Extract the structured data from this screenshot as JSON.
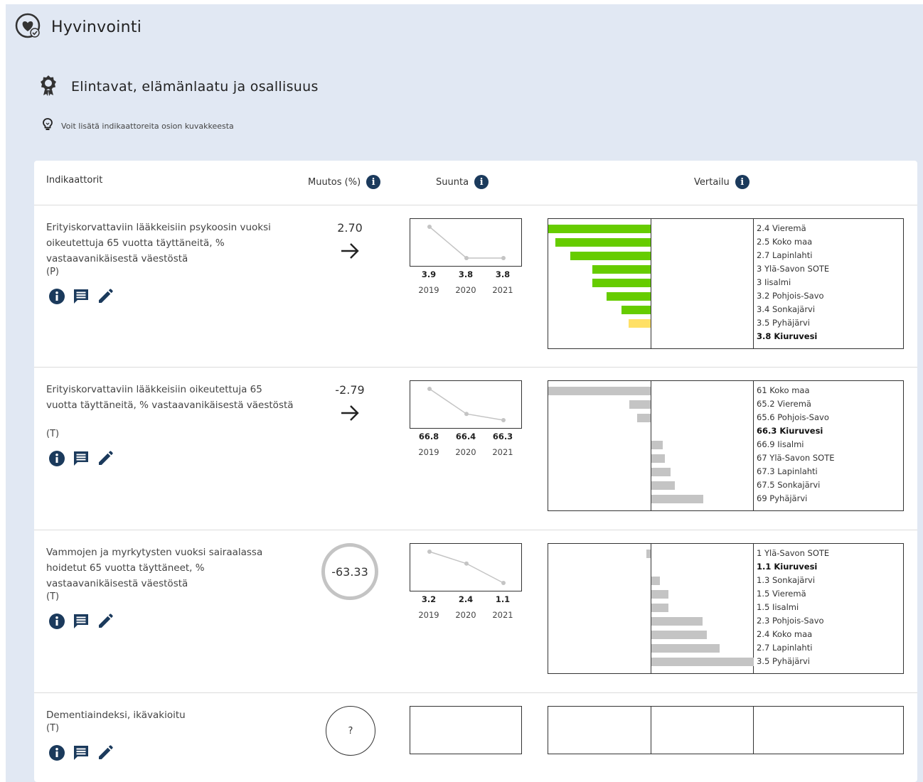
{
  "header": {
    "title": "Hyvinvointi",
    "icon": "heart-check-icon"
  },
  "section": {
    "title": "Elintavat, elämänlaatu ja osallisuus",
    "icon": "award-ribbon-icon"
  },
  "hint": {
    "text": "Voit lisätä indikaattoreita osion kuvakkeesta",
    "icon": "lightbulb-icon"
  },
  "columns": {
    "indicators": "Indikaattorit",
    "change": "Muutos (%)",
    "trend": "Suunta",
    "comparison": "Vertailu"
  },
  "colors": {
    "background": "#e1e8f3",
    "info_badge": "#1b3a5c",
    "bar_good": "#66cc00",
    "bar_mid": "#ffe066",
    "bar_neutral": "#c4c4c4"
  },
  "rows": [
    {
      "name": "Erityiskorvattaviin lääkkeisiin psykoosin vuoksi oikeutettuja 65 vuotta täyttäneitä, % vastaavanikäisestä väestöstä",
      "code": "(P)",
      "change": "2.70",
      "change_display": "arrow",
      "arrow": "→",
      "trend": {
        "years": [
          "2019",
          "2020",
          "2021"
        ],
        "values_text": [
          "3.9",
          "3.8",
          "3.8"
        ],
        "values": [
          3.9,
          3.8,
          3.8
        ]
      },
      "comparison": [
        {
          "value": 2.4,
          "text": "2.4 Vieremä",
          "color": "#66cc00",
          "highlight": false
        },
        {
          "value": 2.5,
          "text": "2.5 Koko maa",
          "color": "#66cc00",
          "highlight": false
        },
        {
          "value": 2.7,
          "text": "2.7 Lapinlahti",
          "color": "#66cc00",
          "highlight": false
        },
        {
          "value": 3.0,
          "text": "3 Ylä-Savon SOTE",
          "color": "#66cc00",
          "highlight": false
        },
        {
          "value": 3.0,
          "text": "3 Iisalmi",
          "color": "#66cc00",
          "highlight": false
        },
        {
          "value": 3.2,
          "text": "3.2 Pohjois-Savo",
          "color": "#66cc00",
          "highlight": false
        },
        {
          "value": 3.4,
          "text": "3.4 Sonkajärvi",
          "color": "#66cc00",
          "highlight": false
        },
        {
          "value": 3.5,
          "text": "3.5 Pyhäjärvi",
          "color": "#ffe066",
          "highlight": false
        },
        {
          "value": 3.8,
          "text": "3.8 Kiuruvesi",
          "color": null,
          "highlight": true
        }
      ]
    },
    {
      "name": "Erityiskorvattaviin lääkkeisiin oikeutettuja 65 vuotta täyttäneitä, % vastaavanikäisestä väestöstä",
      "code": "(T)",
      "change": "-2.79",
      "change_display": "arrow",
      "arrow": "→",
      "trend": {
        "years": [
          "2019",
          "2020",
          "2021"
        ],
        "values_text": [
          "66.8",
          "66.4",
          "66.3"
        ],
        "values": [
          66.8,
          66.4,
          66.3
        ]
      },
      "comparison": [
        {
          "value": 61,
          "text": "61 Koko maa",
          "color": "#c4c4c4",
          "highlight": false
        },
        {
          "value": 65.2,
          "text": "65.2 Vieremä",
          "color": "#c4c4c4",
          "highlight": false
        },
        {
          "value": 65.6,
          "text": "65.6 Pohjois-Savo",
          "color": "#c4c4c4",
          "highlight": false
        },
        {
          "value": 66.3,
          "text": "66.3 Kiuruvesi",
          "color": null,
          "highlight": true
        },
        {
          "value": 66.9,
          "text": "66.9 Iisalmi",
          "color": "#c4c4c4",
          "highlight": false
        },
        {
          "value": 67,
          "text": "67 Ylä-Savon SOTE",
          "color": "#c4c4c4",
          "highlight": false
        },
        {
          "value": 67.3,
          "text": "67.3 Lapinlahti",
          "color": "#c4c4c4",
          "highlight": false
        },
        {
          "value": 67.5,
          "text": "67.5 Sonkajärvi",
          "color": "#c4c4c4",
          "highlight": false
        },
        {
          "value": 69,
          "text": "69 Pyhäjärvi",
          "color": "#c4c4c4",
          "highlight": false
        }
      ]
    },
    {
      "name": "Vammojen ja myrkytysten vuoksi sairaalassa hoidetut 65 vuotta täyttäneet, % vastaavanikäisestä väestöstä",
      "code": "(T)",
      "change": "-63.33",
      "change_display": "ring",
      "trend": {
        "years": [
          "2019",
          "2020",
          "2021"
        ],
        "values_text": [
          "3.2",
          "2.4",
          "1.1"
        ],
        "values": [
          3.2,
          2.4,
          1.1
        ]
      },
      "comparison": [
        {
          "value": 1,
          "text": "1 Ylä-Savon SOTE",
          "color": "#c4c4c4",
          "highlight": false
        },
        {
          "value": 1.1,
          "text": "1.1 Kiuruvesi",
          "color": null,
          "highlight": true
        },
        {
          "value": 1.3,
          "text": "1.3 Sonkajärvi",
          "color": "#c4c4c4",
          "highlight": false
        },
        {
          "value": 1.5,
          "text": "1.5 Vieremä",
          "color": "#c4c4c4",
          "highlight": false
        },
        {
          "value": 1.5,
          "text": "1.5 Iisalmi",
          "color": "#c4c4c4",
          "highlight": false
        },
        {
          "value": 2.3,
          "text": "2.3 Pohjois-Savo",
          "color": "#c4c4c4",
          "highlight": false
        },
        {
          "value": 2.4,
          "text": "2.4 Koko maa",
          "color": "#c4c4c4",
          "highlight": false
        },
        {
          "value": 2.7,
          "text": "2.7 Lapinlahti",
          "color": "#c4c4c4",
          "highlight": false
        },
        {
          "value": 3.5,
          "text": "3.5 Pyhäjärvi",
          "color": "#c4c4c4",
          "highlight": false
        }
      ]
    },
    {
      "name": "Dementiaindeksi, ikävakioitu",
      "code": "(T)",
      "change": "?",
      "change_display": "empty-ring",
      "trend": null,
      "comparison": []
    }
  ]
}
